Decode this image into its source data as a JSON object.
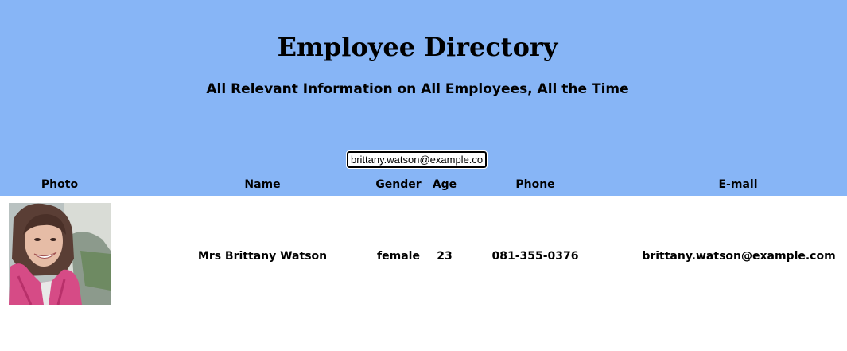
{
  "header": {
    "title": "Employee Directory",
    "subtitle": "All Relevant Information on All Employees, All the Time",
    "background_color": "#87b5f6"
  },
  "search": {
    "value": "brittany.watson@example.co"
  },
  "table": {
    "columns": [
      "Photo",
      "Name",
      "Gender",
      "Age",
      "Phone",
      "E-mail"
    ],
    "rows": [
      {
        "photo_icon": "employee-photo",
        "name": "Mrs Brittany Watson",
        "gender": "female",
        "age": "23",
        "phone": "081-355-0376",
        "email": "brittany.watson@example.com"
      }
    ]
  }
}
